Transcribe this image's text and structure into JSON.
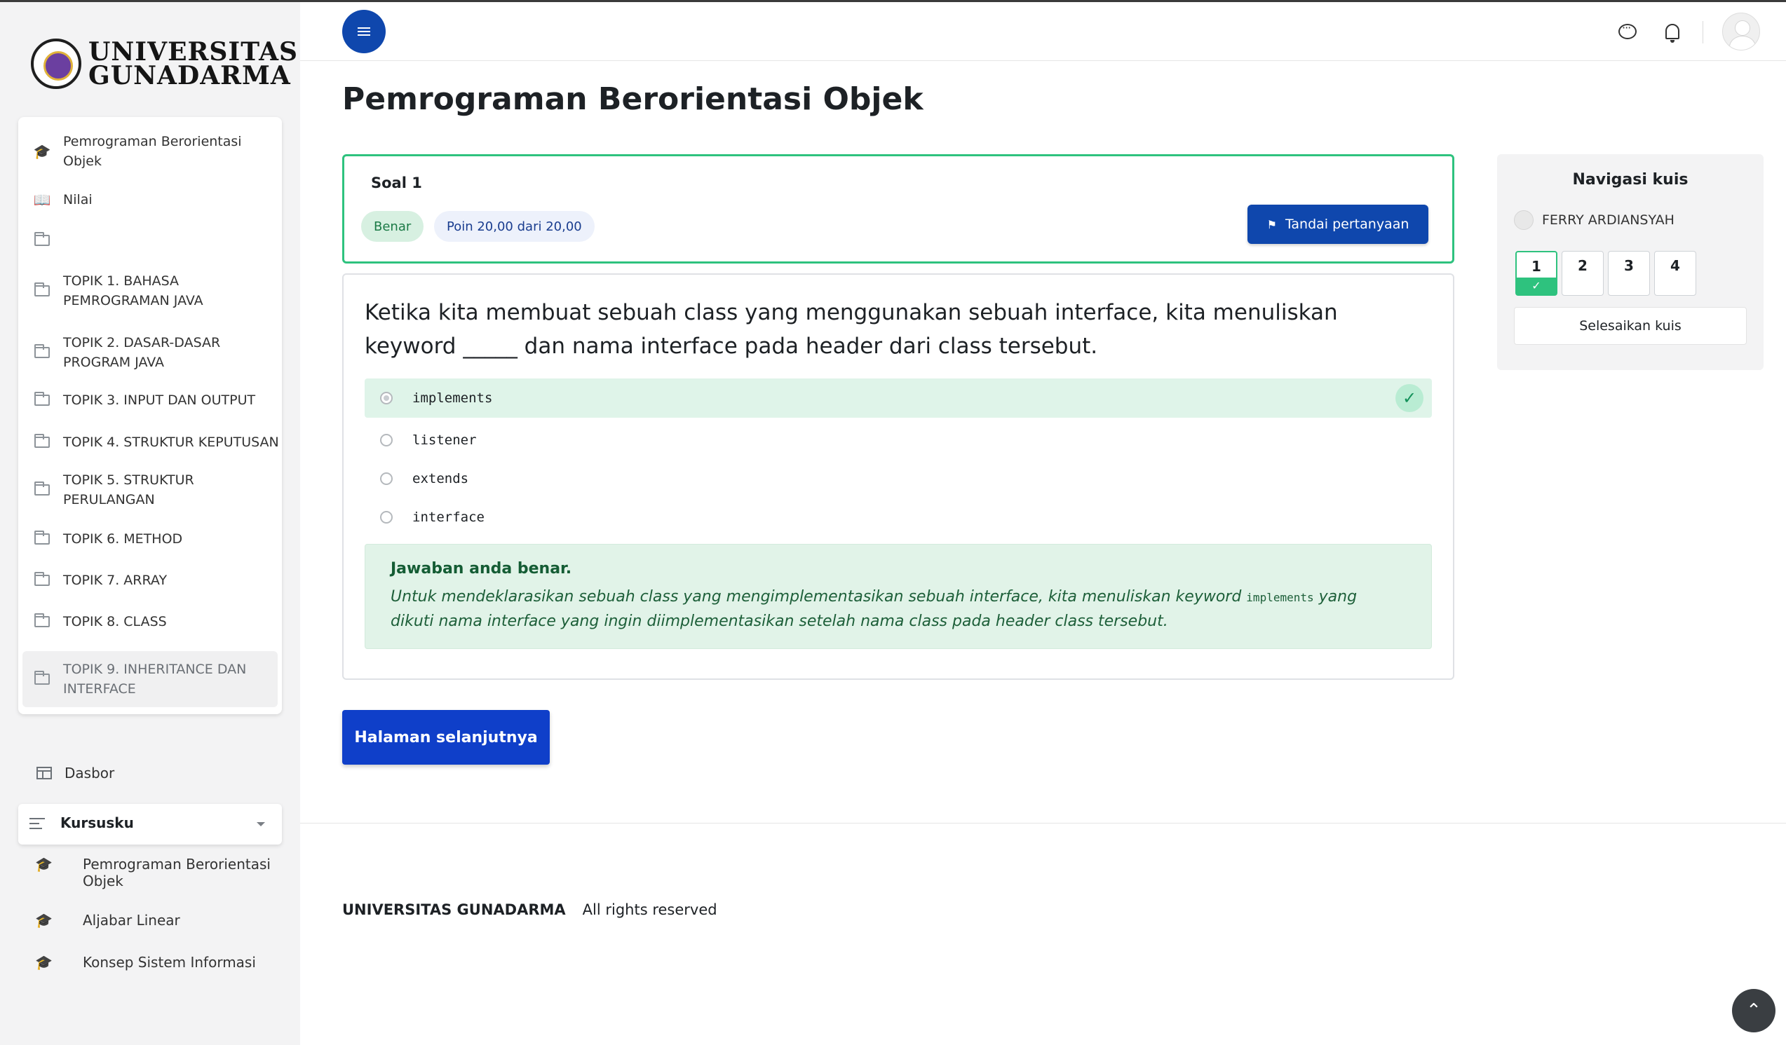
{
  "brand": {
    "logo_line1": "UNIVERSITAS",
    "logo_line2": "GUNADARMA"
  },
  "course_nav": [
    {
      "label": "Pemrograman Berorientasi Objek",
      "icon": "graduation-cap-icon"
    },
    {
      "label": "Nilai",
      "icon": "book-open-icon"
    },
    {
      "label": "",
      "icon": "folder-icon"
    },
    {
      "label": "TOPIK 1. BAHASA PEMROGRAMAN JAVA",
      "icon": "folder-icon"
    },
    {
      "label": "TOPIK 2. DASAR-DASAR PROGRAM JAVA",
      "icon": "folder-icon"
    },
    {
      "label": "TOPIK 3. INPUT DAN OUTPUT",
      "icon": "folder-icon"
    },
    {
      "label": "TOPIK 4. STRUKTUR KEPUTUSAN",
      "icon": "folder-icon"
    },
    {
      "label": "TOPIK 5. STRUKTUR PERULANGAN",
      "icon": "folder-icon"
    },
    {
      "label": "TOPIK 6. METHOD",
      "icon": "folder-icon"
    },
    {
      "label": "TOPIK 7. ARRAY",
      "icon": "folder-icon"
    },
    {
      "label": "TOPIK 8. CLASS",
      "icon": "folder-icon"
    },
    {
      "label": "TOPIK 9. INHERITANCE DAN INTERFACE",
      "icon": "folder-icon"
    }
  ],
  "sidebar": {
    "dasbor": "Dasbor",
    "kursusku": "Kursusku",
    "my_courses": [
      "Pemrograman Berorientasi Objek",
      "Aljabar Linear",
      "Konsep Sistem Informasi"
    ]
  },
  "page": {
    "title": "Pemrograman Berorientasi Objek"
  },
  "question": {
    "number_label": "Soal 1",
    "status": "Benar",
    "points": "Poin 20,00 dari 20,00",
    "flag_button": "Tandai pertanyaan",
    "text": "Ketika kita membuat sebuah class yang menggunakan sebuah interface, kita menuliskan keyword _____ dan nama interface pada header dari class tersebut.",
    "answers": [
      "implements",
      "listener",
      "extends",
      "interface"
    ],
    "selected_answer": "implements",
    "feedback_heading": "Jawaban anda benar.",
    "feedback_before": "Untuk mendeklarasikan sebuah class yang mengimplementasikan sebuah interface, kita menuliskan keyword ",
    "feedback_code": "implements",
    "feedback_after": " yang dikuti nama interface yang ingin diimplementasikan setelah nama class pada header class tersebut."
  },
  "next_button": "Halaman selanjutnya",
  "footer": {
    "brand": "UNIVERSITAS GUNADARMA",
    "rights": "All rights reserved"
  },
  "quiz_nav": {
    "title": "Navigasi kuis",
    "user": "FERRY ARDIANSYAH",
    "questions": [
      "1",
      "2",
      "3",
      "4"
    ],
    "finish": "Selesaikan kuis"
  },
  "colors": {
    "primary": "#0f47ad",
    "success": "#2ec27e",
    "success_bg": "#e1f3e8"
  }
}
